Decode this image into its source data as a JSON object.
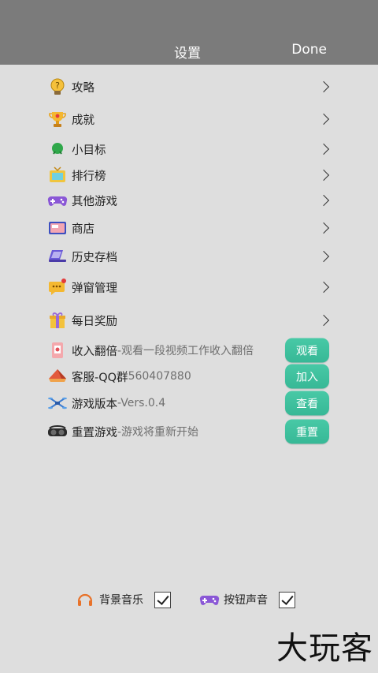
{
  "header": {
    "title": "设置",
    "done_label": "Done",
    "bg_color": "#7b7b7b"
  },
  "menu": [
    {
      "label": "攻略",
      "icon": "lightbulb-question-icon"
    },
    {
      "label": "成就",
      "icon": "trophy-icon"
    },
    {
      "label": "小目标",
      "icon": "green-blob-icon"
    },
    {
      "label": "排行榜",
      "icon": "tv-icon"
    },
    {
      "label": "其他游戏",
      "icon": "gamepad-icon"
    },
    {
      "label": "商店",
      "icon": "shop-card-icon"
    },
    {
      "label": "历史存档",
      "icon": "laptop-icon"
    },
    {
      "label": "弹窗管理",
      "icon": "chat-bubble-icon"
    },
    {
      "label": "每日奖励",
      "icon": "gift-icon"
    }
  ],
  "actions": [
    {
      "label": "收入翻倍",
      "sub": "-观看一段视频工作收入翻倍",
      "button": "观看",
      "icon": "card-icon"
    },
    {
      "label": "客服-QQ群",
      "sub": " 560407880",
      "button": "加入",
      "icon": "tent-icon"
    },
    {
      "label": "游戏版本",
      "sub": "-Vers.0.4",
      "button": "查看",
      "icon": "drone-icon"
    },
    {
      "label": "重置游戏",
      "sub": "-游戏将重新开始",
      "button": "重置",
      "icon": "vr-goggles-icon"
    }
  ],
  "toggles": {
    "music": {
      "label": "背景音乐",
      "checked": true,
      "icon": "headphones-icon"
    },
    "sound": {
      "label": "按钮声音",
      "checked": true,
      "icon": "gamepad-icon"
    }
  },
  "watermark": "大玩客",
  "colors": {
    "background": "#dedede",
    "accent": "#3fc09e"
  }
}
